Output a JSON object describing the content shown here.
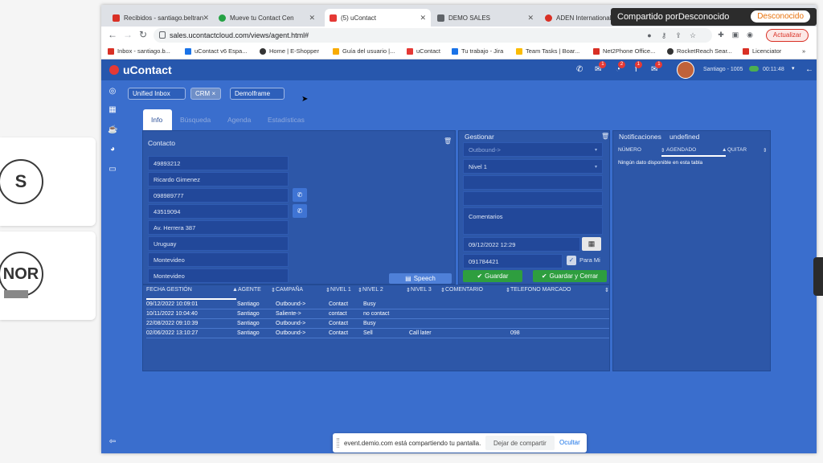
{
  "participants": [
    {
      "initial": "S"
    },
    {
      "initial": "NOR"
    }
  ],
  "browser": {
    "tabs": [
      {
        "label": "Recibidos - santiago.beltran",
        "color": "#d93025"
      },
      {
        "label": "Mueve tu Contact Cen",
        "color": "#25a244"
      },
      {
        "label": "(5) uContact",
        "color": "#e53935"
      },
      {
        "label": "DEMO SALES",
        "color": "#5f6368"
      },
      {
        "label": "ADEN International Bu",
        "color": "#d93025"
      }
    ],
    "share_banner": {
      "text": "Compartido porDesconocido",
      "button": "Desconocido"
    },
    "url": "sales.ucontactcloud.com/views/agent.html#",
    "update_button": "Actualizar",
    "bookmarks": [
      {
        "label": "Inbox - santiago.b...",
        "color": "#d93025"
      },
      {
        "label": "uContact v6 Espa...",
        "color": "#1a73e8"
      },
      {
        "label": "Home | E-Shopper",
        "color": "#333333"
      },
      {
        "label": "Guía del usuario |...",
        "color": "#f9ab00"
      },
      {
        "label": "uContact",
        "color": "#e53935"
      },
      {
        "label": "Tu trabajo - Jira",
        "color": "#1a73e8"
      },
      {
        "label": "Team Tasks | Boar...",
        "color": "#fbbc04"
      },
      {
        "label": "Net2Phone Office...",
        "color": "#d93025"
      },
      {
        "label": "RocketReach Sear...",
        "color": "#333333"
      },
      {
        "label": "Licenciator",
        "color": "#d93025"
      }
    ]
  },
  "app": {
    "logo": "uContact",
    "badges": {
      "chat": "1",
      "whatsapp": "2",
      "facebook": "1",
      "mail": "1"
    },
    "agent": "Santiago - 1005",
    "timer": "00:11:48",
    "pills": {
      "inbox": "Unified Inbox",
      "crm": "CRM ×",
      "frame": "DemoIframe"
    },
    "info_tabs": [
      "Info",
      "Búsqueda",
      "Agenda",
      "Estadísticas"
    ],
    "contacto": {
      "title": "Contacto",
      "fields": [
        "49893212",
        "Ricardo Gimenez",
        "098989777",
        "43519094",
        "Av. Herrera 387",
        "Uruguay",
        "Montevideo",
        "Montevideo"
      ],
      "speech": "Speech"
    },
    "gestionar": {
      "title": "Gestionar",
      "campaign": "Outbound->",
      "level": "Nivel 1",
      "comments_placeholder": "Comentarios",
      "date": "09/12/2022 12:29",
      "phone": "091784421",
      "para_mi": "Para Mi",
      "save": "Guardar",
      "save_close": "Guardar y Cerrar"
    },
    "notificaciones": {
      "title": "Notificaciones",
      "title_value": "undefined",
      "columns": [
        "NÚMERO",
        "AGENDADO",
        "QUITAR"
      ],
      "empty": "Ningún dato disponible en esta tabla"
    },
    "gestiones": {
      "columns": [
        "FECHA GESTIÓN",
        "AGENTE",
        "CAMPAÑA",
        "NIVEL 1",
        "NIVEL 2",
        "NIVEL 3",
        "COMENTARIO",
        "TELEFONO MARCADO"
      ],
      "rows": [
        [
          "09/12/2022 10:09:01",
          "Santiago",
          "Outbound->",
          "Contact",
          "Busy",
          "",
          "",
          ""
        ],
        [
          "10/11/2022 10:04:40",
          "Santiago",
          "Saliente->",
          "contact",
          "no contact",
          "",
          "",
          ""
        ],
        [
          "22/08/2022 09:10:39",
          "Santiago",
          "Outbound->",
          "Contact",
          "Busy",
          "",
          "",
          ""
        ],
        [
          "02/06/2022 13:10:27",
          "Santiago",
          "Outbound->",
          "Contact",
          "Sell",
          "Call later",
          "",
          "098"
        ]
      ]
    },
    "screen_share": {
      "text": "event.demio.com está compartiendo tu pantalla.",
      "stop": "Dejar de compartir",
      "hide": "Ocultar"
    }
  }
}
